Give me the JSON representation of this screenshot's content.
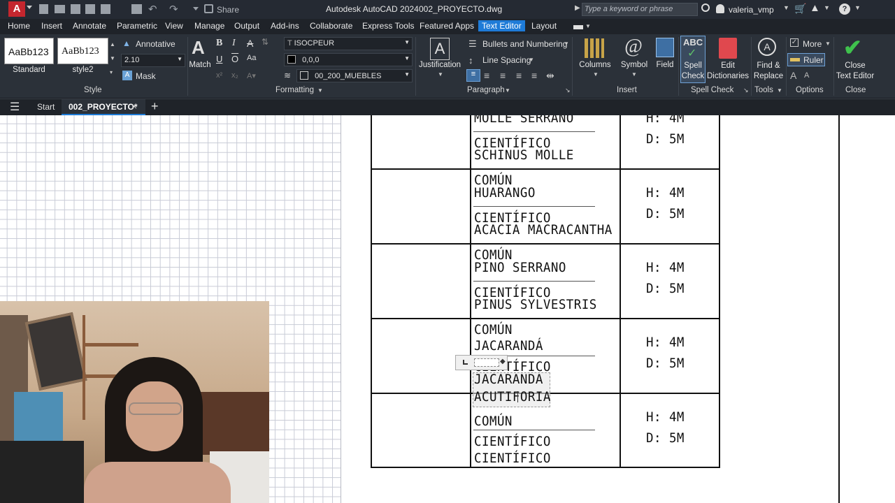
{
  "titlebar": {
    "app_title": "Autodesk AutoCAD 2024",
    "file_name": "002_PROYECTO.dwg",
    "share_label": "Share",
    "search_placeholder": "Type a keyword or phrase",
    "user_name": "valeria_vmp"
  },
  "ribbon_tabs": [
    "Home",
    "Insert",
    "Annotate",
    "Parametric",
    "View",
    "Manage",
    "Output",
    "Add-ins",
    "Collaborate",
    "Express Tools",
    "Featured Apps",
    "Text Editor",
    "Layout"
  ],
  "ribbon": {
    "style": {
      "preview1": "AaBb123",
      "preview1_name": "Standard",
      "preview2": "AaBb123",
      "preview2_name": "style2",
      "annotative": "Annotative",
      "height": "2.10",
      "mask": "Mask",
      "panel": "Style"
    },
    "formatting": {
      "match": "Match",
      "font": "ISOCPEUR",
      "color": "0,0,0",
      "layer": "00_200_MUEBLES",
      "panel": "Formatting"
    },
    "paragraph": {
      "justification": "Justification",
      "bullets": "Bullets and Numbering",
      "line_spacing": "Line Spacing",
      "panel": "Paragraph"
    },
    "insert": {
      "columns": "Columns",
      "symbol": "Symbol",
      "field": "Field",
      "panel": "Insert"
    },
    "spell": {
      "spell_check_1": "Spell",
      "spell_check_2": "Check",
      "edit_dict_1": "Edit",
      "edit_dict_2": "Dictionaries",
      "panel": "Spell Check",
      "abc": "ABC"
    },
    "tools": {
      "find_1": "Find &",
      "find_2": "Replace",
      "panel": "Tools"
    },
    "options": {
      "more": "More",
      "ruler": "Ruler",
      "panel": "Options"
    },
    "close": {
      "label_1": "Close",
      "label_2": "Text Editor",
      "panel": "Close"
    }
  },
  "doc_tabs": {
    "start": "Start",
    "active": "002_PROYECTO*"
  },
  "drawing": {
    "rows": [
      {
        "comun_label": "",
        "comun_name": "MOLLE SERRANO",
        "cient_label": "CIENTÍFICO",
        "cient_name": "SCHINUS MOLLE",
        "h": "H: 4M",
        "d": "D: 5M"
      },
      {
        "comun_label": "COMÚN",
        "comun_name": "HUARANGO",
        "cient_label": "CIENTÍFICO",
        "cient_name": "ACACIA MACRACANTHA",
        "h": "H: 4M",
        "d": "D: 5M"
      },
      {
        "comun_label": "COMÚN",
        "comun_name": "PINO SERRANO",
        "cient_label": "CIENTÍFICO",
        "cient_name": "PINUS SYLVESTRIS",
        "h": "H: 4M",
        "d": "D: 5M"
      },
      {
        "comun_label": "COMÚN",
        "comun_name": "JACARANDÁ",
        "cient_label": "CIENTÍFICO",
        "cient_name": "JACARANDA",
        "cient_name2": "ACUTIFORIA",
        "h": "H: 4M",
        "d": "D: 5M"
      },
      {
        "comun_label": "COMÚN",
        "comun_name": "",
        "cient_label": "CIENTÍFICO",
        "cient_name": "CIENTÍFICO",
        "h": "H: 4M",
        "d": "D: 5M"
      }
    ]
  },
  "colors": {
    "accent": "#1e7bd7",
    "ribbon_bg": "#2b3139",
    "title_bg": "#252a33"
  }
}
